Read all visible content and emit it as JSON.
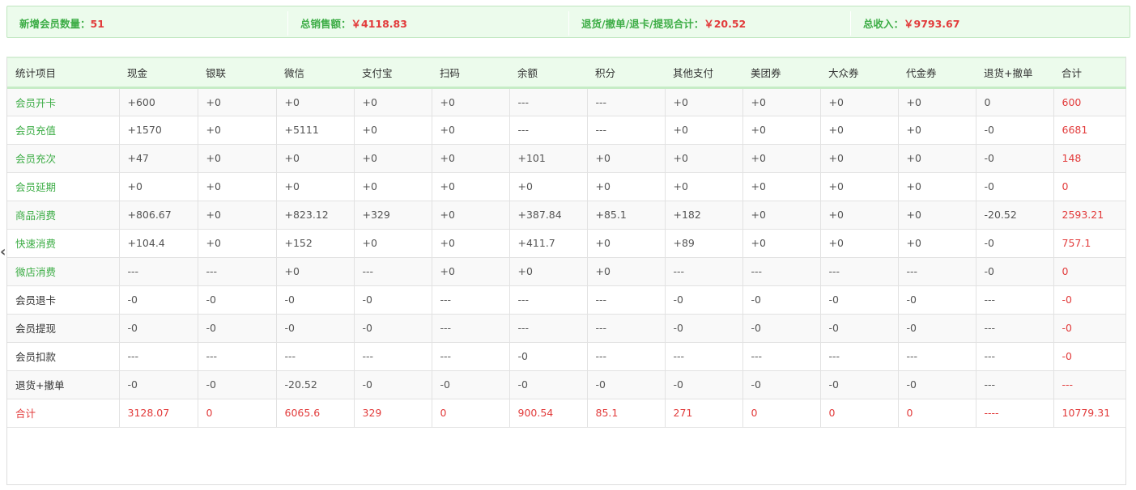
{
  "summary": [
    {
      "label": "新增会员数量：",
      "value": "51"
    },
    {
      "label": "总销售额：",
      "value": "￥4118.83"
    },
    {
      "label": "退货/撤单/退卡/提现合计：",
      "value": "￥20.52"
    },
    {
      "label": "总收入：",
      "value": "￥9793.67"
    }
  ],
  "columns": [
    "统计项目",
    "现金",
    "银联",
    "微信",
    "支付宝",
    "扫码",
    "余额",
    "积分",
    "其他支付",
    "美团券",
    "大众券",
    "代金券",
    "退货+撤单",
    "合计"
  ],
  "rows": [
    {
      "label": "会员开卡",
      "green": true,
      "cells": [
        "+600",
        "+0",
        "+0",
        "+0",
        "+0",
        "---",
        "---",
        "+0",
        "+0",
        "+0",
        "+0",
        "0",
        "600"
      ]
    },
    {
      "label": "会员充值",
      "green": true,
      "cells": [
        "+1570",
        "+0",
        "+5111",
        "+0",
        "+0",
        "---",
        "---",
        "+0",
        "+0",
        "+0",
        "+0",
        "-0",
        "6681"
      ]
    },
    {
      "label": "会员充次",
      "green": true,
      "cells": [
        "+47",
        "+0",
        "+0",
        "+0",
        "+0",
        "+101",
        "+0",
        "+0",
        "+0",
        "+0",
        "+0",
        "-0",
        "148"
      ]
    },
    {
      "label": "会员延期",
      "green": true,
      "cells": [
        "+0",
        "+0",
        "+0",
        "+0",
        "+0",
        "+0",
        "+0",
        "+0",
        "+0",
        "+0",
        "+0",
        "-0",
        "0"
      ]
    },
    {
      "label": "商品消费",
      "green": true,
      "cells": [
        "+806.67",
        "+0",
        "+823.12",
        "+329",
        "+0",
        "+387.84",
        "+85.1",
        "+182",
        "+0",
        "+0",
        "+0",
        "-20.52",
        "2593.21"
      ]
    },
    {
      "label": "快速消费",
      "green": true,
      "cells": [
        "+104.4",
        "+0",
        "+152",
        "+0",
        "+0",
        "+411.7",
        "+0",
        "+89",
        "+0",
        "+0",
        "+0",
        "-0",
        "757.1"
      ]
    },
    {
      "label": "微店消费",
      "green": true,
      "cells": [
        "---",
        "---",
        "+0",
        "---",
        "+0",
        "+0",
        "+0",
        "---",
        "---",
        "---",
        "---",
        "-0",
        "0"
      ]
    },
    {
      "label": "会员退卡",
      "green": false,
      "cells": [
        "-0",
        "-0",
        "-0",
        "-0",
        "---",
        "---",
        "---",
        "-0",
        "-0",
        "-0",
        "-0",
        "---",
        "-0"
      ]
    },
    {
      "label": "会员提现",
      "green": false,
      "cells": [
        "-0",
        "-0",
        "-0",
        "-0",
        "---",
        "---",
        "---",
        "-0",
        "-0",
        "-0",
        "-0",
        "---",
        "-0"
      ]
    },
    {
      "label": "会员扣款",
      "green": false,
      "cells": [
        "---",
        "---",
        "---",
        "---",
        "---",
        "-0",
        "---",
        "---",
        "---",
        "---",
        "---",
        "---",
        "-0"
      ]
    },
    {
      "label": "退货+撤单",
      "green": false,
      "cells": [
        "-0",
        "-0",
        "-20.52",
        "-0",
        "-0",
        "-0",
        "-0",
        "-0",
        "-0",
        "-0",
        "-0",
        "---",
        "---"
      ]
    }
  ],
  "total_row": {
    "label": "合计",
    "cells": [
      "3128.07",
      "0",
      "6065.6",
      "329",
      "0",
      "900.54",
      "85.1",
      "271",
      "0",
      "0",
      "0",
      "----",
      "10779.31"
    ]
  },
  "nav": {
    "prev_icon": "chevron-left-icon",
    "prev_glyph": "‹"
  },
  "colors": {
    "accent_green": "#3dad46",
    "value_red": "#e23b3b",
    "panel_bg": "#ecfbec"
  }
}
